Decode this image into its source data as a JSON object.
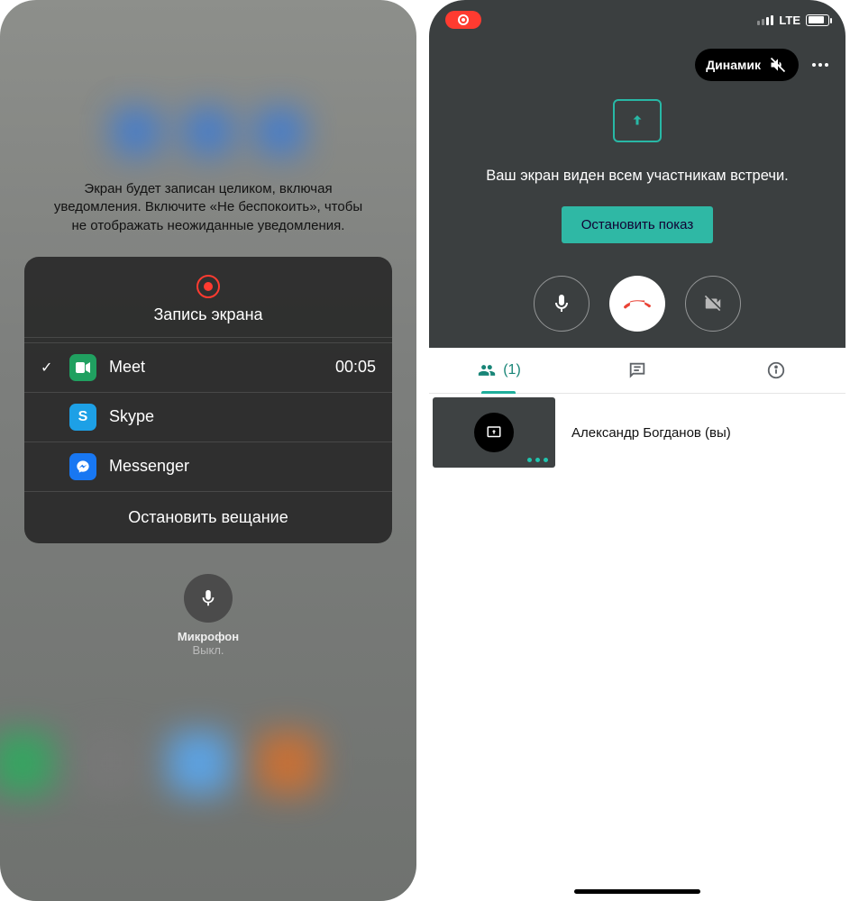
{
  "left": {
    "hint": "Экран будет записан целиком, включая уведомления. Включите «Не беспокоить», чтобы не отображать неожиданные уведомления.",
    "card_title": "Запись экрана",
    "apps": [
      {
        "name": "Meet",
        "time": "00:05",
        "checked": true,
        "color": "#20a060"
      },
      {
        "name": "Skype",
        "time": "",
        "checked": false,
        "color": "#1da0e6"
      },
      {
        "name": "Messenger",
        "time": "",
        "checked": false,
        "color": "#1877f2"
      }
    ],
    "stop_label": "Остановить вещание",
    "mic_label": "Микрофон",
    "mic_state": "Выкл."
  },
  "right": {
    "status": {
      "network": "LTE"
    },
    "speaker_label": "Динамик",
    "share_text": "Ваш экран виден всем участникам встречи.",
    "stop_share_label": "Остановить показ",
    "tabs": {
      "people_count": "(1)"
    },
    "participant_name": "Александр Богданов (вы)"
  }
}
